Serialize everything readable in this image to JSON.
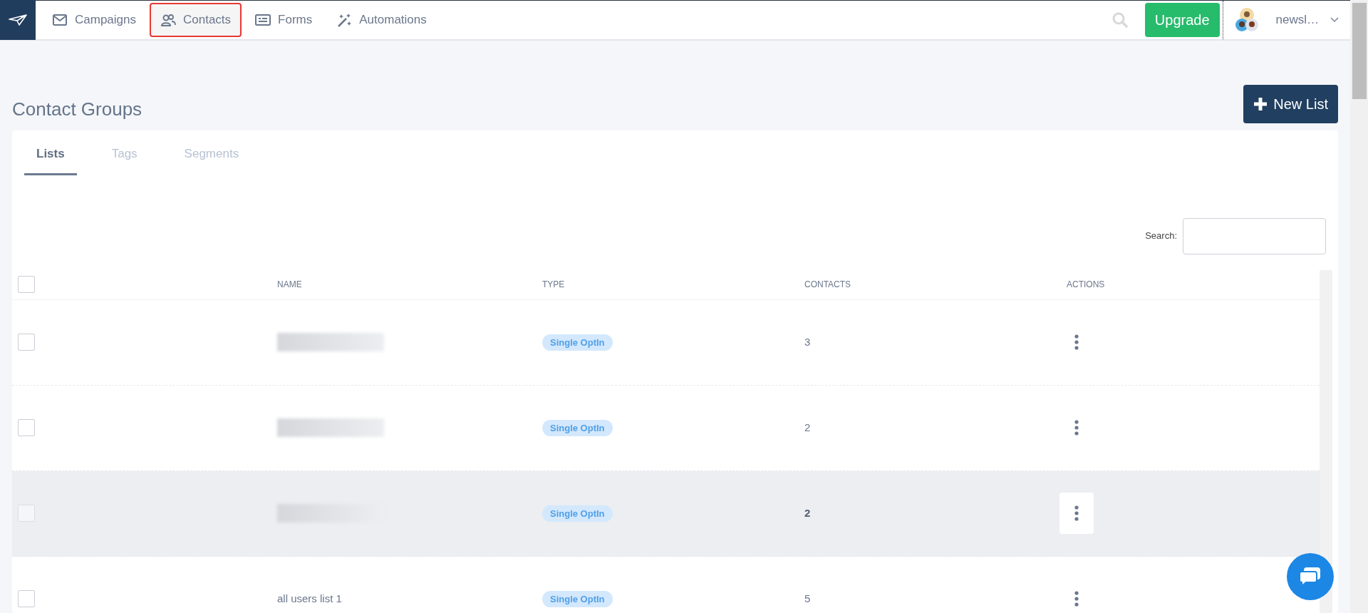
{
  "nav": {
    "items": [
      {
        "label": "Campaigns",
        "selected": false
      },
      {
        "label": "Contacts",
        "selected": true
      },
      {
        "label": "Forms",
        "selected": false
      },
      {
        "label": "Automations",
        "selected": false
      }
    ],
    "upgrade": "Upgrade",
    "account": "newsl…"
  },
  "page": {
    "title": "Contact Groups",
    "new_button": "New List"
  },
  "tabs": [
    {
      "label": "Lists",
      "selected": true
    },
    {
      "label": "Tags",
      "selected": false
    },
    {
      "label": "Segments",
      "selected": false
    }
  ],
  "search": {
    "label": "Search:"
  },
  "table": {
    "select_all_checked": false,
    "columns": [
      "NAME",
      "TYPE",
      "CONTACTS",
      "ACTIONS"
    ],
    "rows": [
      {
        "kind": "redacted",
        "type": "Single OptIn",
        "contacts": "3",
        "hovered": false,
        "checked": false
      },
      {
        "kind": "redacted",
        "type": "Single OptIn",
        "contacts": "2",
        "hovered": false,
        "checked": false
      },
      {
        "kind": "redacted",
        "type": "Single OptIn",
        "contacts": "2",
        "hovered": true,
        "checked": false
      },
      {
        "kind": "text",
        "name": "all users list 1",
        "type": "Single OptIn",
        "contacts": "5",
        "hovered": false,
        "checked": false
      }
    ]
  }
}
